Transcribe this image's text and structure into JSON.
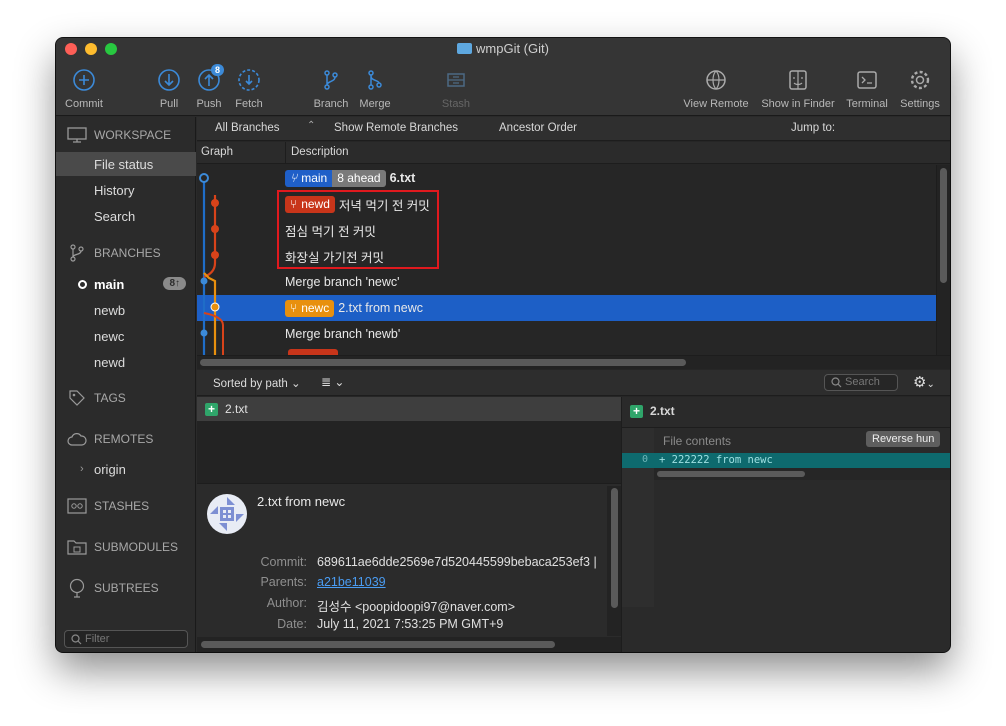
{
  "window": {
    "title": "wmpGit (Git)"
  },
  "toolbar": {
    "commit": "Commit",
    "pull": "Pull",
    "push": "Push",
    "push_badge": "8",
    "fetch": "Fetch",
    "branch": "Branch",
    "merge": "Merge",
    "stash": "Stash",
    "view_remote": "View Remote",
    "show_in_finder": "Show in Finder",
    "terminal": "Terminal",
    "settings": "Settings"
  },
  "sidebar": {
    "workspace": "WORKSPACE",
    "workspace_items": [
      "File status",
      "History",
      "Search"
    ],
    "branches": "BRANCHES",
    "branch_items": [
      "main",
      "newb",
      "newc",
      "newd"
    ],
    "main_badge": "8↑",
    "tags": "TAGS",
    "remotes": "REMOTES",
    "remote_items": [
      "origin"
    ],
    "stashes": "STASHES",
    "submodules": "SUBMODULES",
    "subtrees": "SUBTREES",
    "filter_placeholder": "Filter"
  },
  "options": {
    "branches": "All Branches",
    "remote": "Show Remote Branches",
    "order": "Ancestor Order",
    "jump": "Jump to:"
  },
  "columns": {
    "graph": "Graph",
    "description": "Description"
  },
  "commits": [
    {
      "labels": [
        {
          "text": "main",
          "color": "#1f5fc8"
        },
        {
          "text": "8 ahead",
          "color": "#7a7a7a"
        }
      ],
      "message": "6.txt",
      "bold": true
    },
    {
      "labels": [
        {
          "text": "newd",
          "color": "#c8351a"
        }
      ],
      "message": "저녁 먹기 전 커밋"
    },
    {
      "labels": [],
      "message": "점심 먹기 전 커밋"
    },
    {
      "labels": [],
      "message": "화장실 가기전 커밋"
    },
    {
      "labels": [],
      "message": "Merge branch 'newc'"
    },
    {
      "labels": [
        {
          "text": "newc",
          "color": "#e8900e"
        }
      ],
      "message": "2.txt from newc"
    },
    {
      "labels": [],
      "message": "Merge branch 'newb'"
    }
  ],
  "files_bar": {
    "sort": "Sorted by path",
    "search_placeholder": "Search"
  },
  "files": [
    {
      "name": "2.txt",
      "status": "added"
    }
  ],
  "commit_details": {
    "message": "2.txt from newc",
    "commit_label": "Commit:",
    "commit": "689611ae6dde2569e7d520445599bebaca253ef3 |",
    "parents_label": "Parents:",
    "parents": "a21be11039",
    "author_label": "Author:",
    "author": "김성수 <poopidoopi97@naver.com>",
    "date_label": "Date:",
    "date": "July 11, 2021 7:53:25 PM GMT+9"
  },
  "diff": {
    "file": "2.txt",
    "header": "File contents",
    "reverse_button": "Reverse hun",
    "line_no": "0",
    "line": "+ 222222 from newc"
  },
  "colors": {
    "accent": "#1d5fc6",
    "main_branch": "#1f5fc8",
    "newd_branch": "#c8351a",
    "newc_branch": "#e8900e",
    "highlight_box": "#e0191e",
    "added": "#2fa56a"
  }
}
